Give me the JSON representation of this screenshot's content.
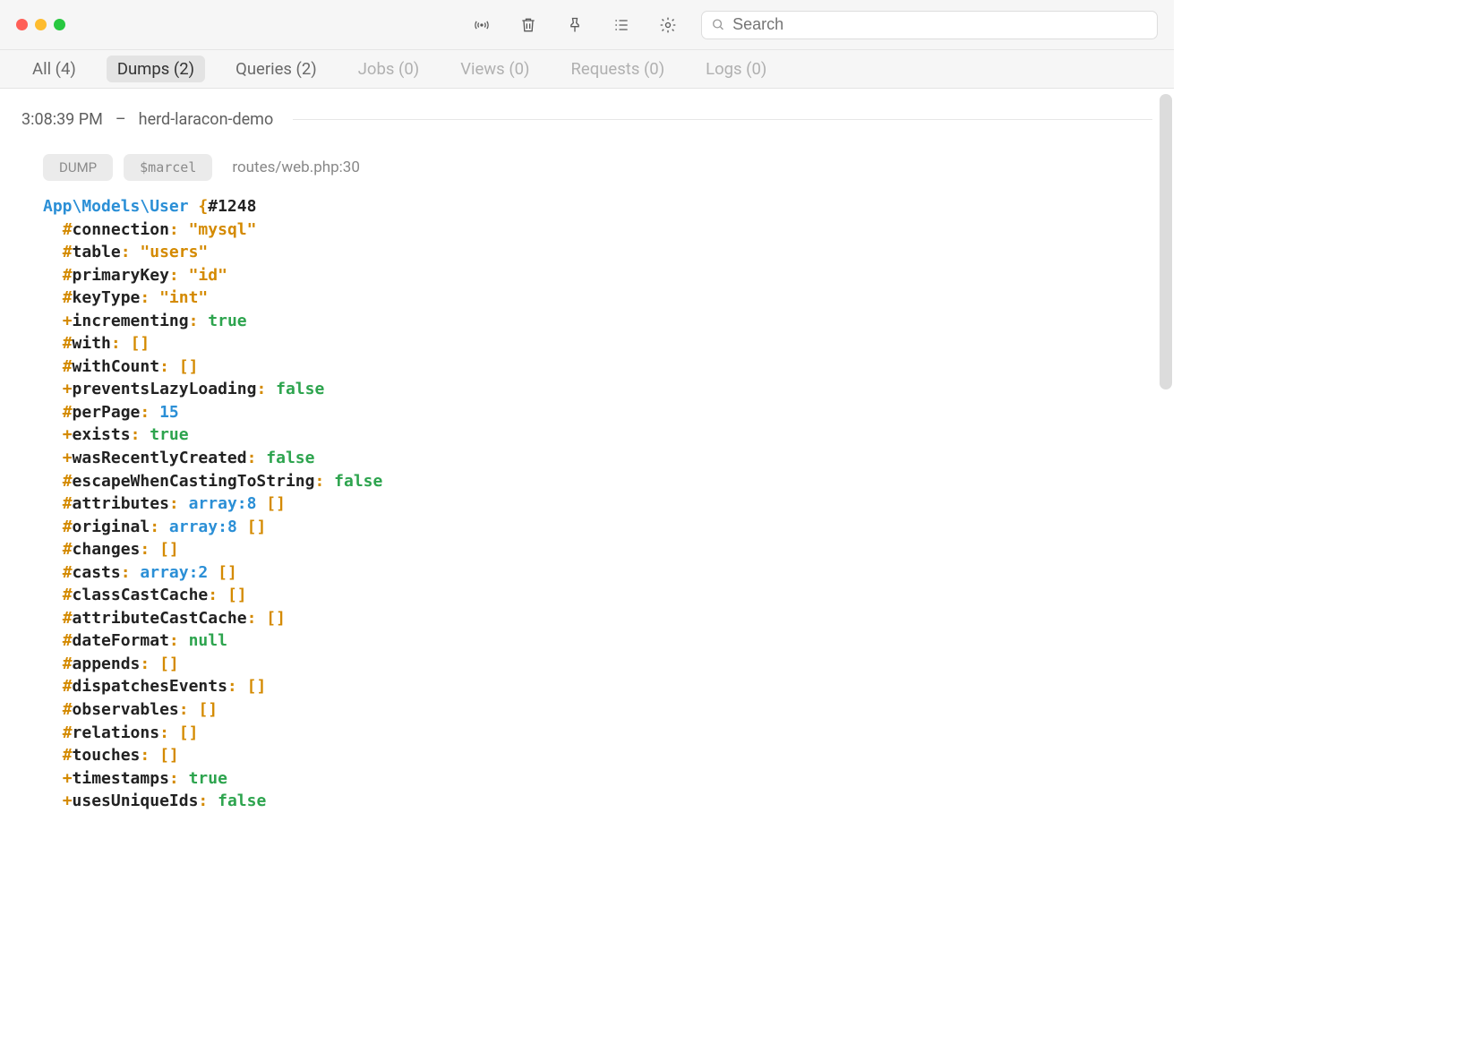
{
  "search": {
    "placeholder": "Search"
  },
  "tabs": [
    {
      "label": "All (4)",
      "state": "normal"
    },
    {
      "label": "Dumps (2)",
      "state": "active"
    },
    {
      "label": "Queries (2)",
      "state": "normal"
    },
    {
      "label": "Jobs (0)",
      "state": "dim"
    },
    {
      "label": "Views (0)",
      "state": "dim"
    },
    {
      "label": "Requests (0)",
      "state": "dim"
    },
    {
      "label": "Logs (0)",
      "state": "dim"
    }
  ],
  "meta": {
    "time": "3:08:39 PM",
    "sep": "–",
    "app": "herd-laracon-demo"
  },
  "badges": {
    "dump": "DUMP",
    "var": "$marcel",
    "file": "routes/web.php:30"
  },
  "dump": {
    "className": "App\\Models\\User",
    "id": "#1248",
    "props": [
      {
        "vis": "#",
        "name": "connection",
        "type": "str",
        "value": "\"mysql\""
      },
      {
        "vis": "#",
        "name": "table",
        "type": "str",
        "value": "\"users\""
      },
      {
        "vis": "#",
        "name": "primaryKey",
        "type": "str",
        "value": "\"id\""
      },
      {
        "vis": "#",
        "name": "keyType",
        "type": "str",
        "value": "\"int\""
      },
      {
        "vis": "+",
        "name": "incrementing",
        "type": "bool",
        "value": "true"
      },
      {
        "vis": "#",
        "name": "with",
        "type": "arrb",
        "value": "[]"
      },
      {
        "vis": "#",
        "name": "withCount",
        "type": "arrb",
        "value": "[]"
      },
      {
        "vis": "+",
        "name": "preventsLazyLoading",
        "type": "bool",
        "value": "false"
      },
      {
        "vis": "#",
        "name": "perPage",
        "type": "num",
        "value": "15"
      },
      {
        "vis": "+",
        "name": "exists",
        "type": "bool",
        "value": "true"
      },
      {
        "vis": "+",
        "name": "wasRecentlyCreated",
        "type": "bool",
        "value": "false"
      },
      {
        "vis": "#",
        "name": "escapeWhenCastingToString",
        "type": "bool",
        "value": "false"
      },
      {
        "vis": "#",
        "name": "attributes",
        "type": "arr",
        "value": "array:8",
        "suffix": " []"
      },
      {
        "vis": "#",
        "name": "original",
        "type": "arr",
        "value": "array:8",
        "suffix": " []"
      },
      {
        "vis": "#",
        "name": "changes",
        "type": "arrb",
        "value": "[]"
      },
      {
        "vis": "#",
        "name": "casts",
        "type": "arr",
        "value": "array:2",
        "suffix": " []"
      },
      {
        "vis": "#",
        "name": "classCastCache",
        "type": "arrb",
        "value": "[]"
      },
      {
        "vis": "#",
        "name": "attributeCastCache",
        "type": "arrb",
        "value": "[]"
      },
      {
        "vis": "#",
        "name": "dateFormat",
        "type": "null",
        "value": "null"
      },
      {
        "vis": "#",
        "name": "appends",
        "type": "arrb",
        "value": "[]"
      },
      {
        "vis": "#",
        "name": "dispatchesEvents",
        "type": "arrb",
        "value": "[]"
      },
      {
        "vis": "#",
        "name": "observables",
        "type": "arrb",
        "value": "[]"
      },
      {
        "vis": "#",
        "name": "relations",
        "type": "arrb",
        "value": "[]"
      },
      {
        "vis": "#",
        "name": "touches",
        "type": "arrb",
        "value": "[]"
      },
      {
        "vis": "+",
        "name": "timestamps",
        "type": "bool",
        "value": "true"
      },
      {
        "vis": "+",
        "name": "usesUniqueIds",
        "type": "bool",
        "value": "false"
      }
    ]
  }
}
